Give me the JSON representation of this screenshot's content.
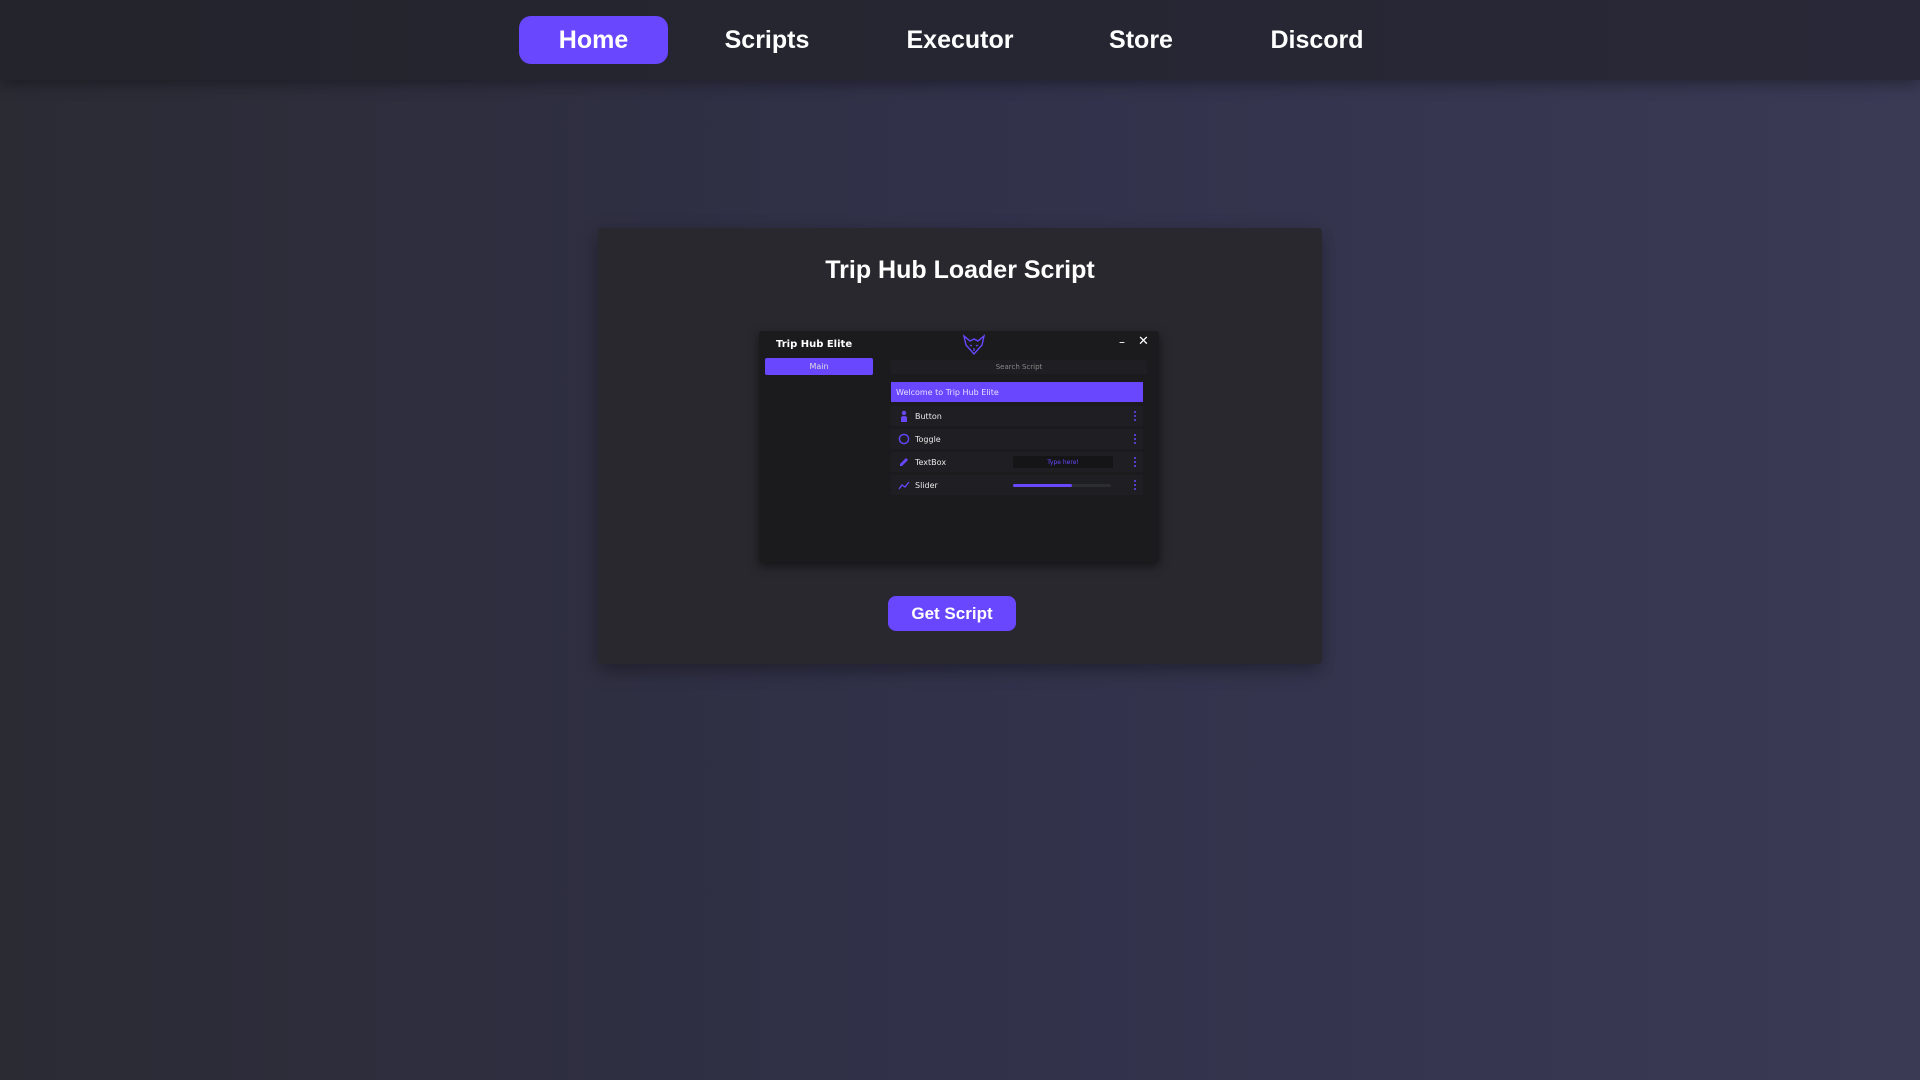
{
  "nav": {
    "items": [
      {
        "label": "Home",
        "active": true
      },
      {
        "label": "Scripts",
        "active": false
      },
      {
        "label": "Executor",
        "active": false
      },
      {
        "label": "Store",
        "active": false
      },
      {
        "label": "Discord",
        "active": false
      }
    ]
  },
  "card": {
    "title": "Trip Hub Loader Script",
    "button_label": "Get Script"
  },
  "preview": {
    "window_title": "Trip Hub Elite",
    "logo_icon": "fox-logo-icon",
    "minimize_glyph": "–",
    "close_glyph": "✕",
    "sidebar_tab": "Main",
    "search_placeholder": "Search Script",
    "welcome_text": "Welcome to Trip Hub Elite",
    "rows": [
      {
        "label": "Button",
        "icon": "touch-icon"
      },
      {
        "label": "Toggle",
        "icon": "circle-toggle-icon"
      },
      {
        "label": "TextBox",
        "icon": "pencil-icon",
        "placeholder": "Type here!"
      },
      {
        "label": "Slider",
        "icon": "trend-icon",
        "value": 0.6
      }
    ]
  },
  "colors": {
    "accent": "#6847ff",
    "card_bg": "#28282e",
    "window_bg": "#1b1b1e"
  }
}
